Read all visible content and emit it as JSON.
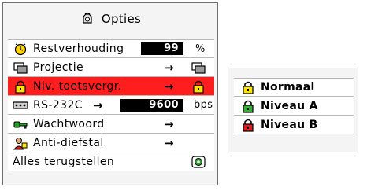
{
  "menu": {
    "title": "Opties",
    "items": [
      {
        "label": "Restverhouding",
        "value": "99",
        "unit": "%",
        "icon": "clock-timer-icon"
      },
      {
        "label": "Projectie",
        "arrow": "→",
        "icon": "projection-icon",
        "value_icon": "projection-icon"
      },
      {
        "label": "Niv. toetsvergr.",
        "arrow": "→",
        "icon": "padlock-icon",
        "value_icon": "padlock-icon"
      },
      {
        "label": "RS-232C",
        "arrow": "→",
        "value": "9600",
        "unit": "bps",
        "icon": "rs232-port-icon"
      },
      {
        "label": "Wachtwoord",
        "arrow": "→",
        "icon": "key-icon"
      },
      {
        "label": "Anti-diefstal",
        "arrow": "→",
        "icon": "anti-theft-icon"
      },
      {
        "label": "Alles terugstellen",
        "icon": "reset-icon"
      }
    ],
    "selected_index": 2
  },
  "submenu": {
    "items": [
      {
        "label": "Normaal",
        "icon": "padlock-open-icon"
      },
      {
        "label": "Niveau A",
        "icon": "padlock-icon"
      },
      {
        "label": "Niveau B",
        "icon": "padlock-red-icon"
      }
    ]
  },
  "colors": {
    "highlight": "#ff1e1e",
    "background": "#f4f4f4",
    "value_box": "#000000"
  }
}
